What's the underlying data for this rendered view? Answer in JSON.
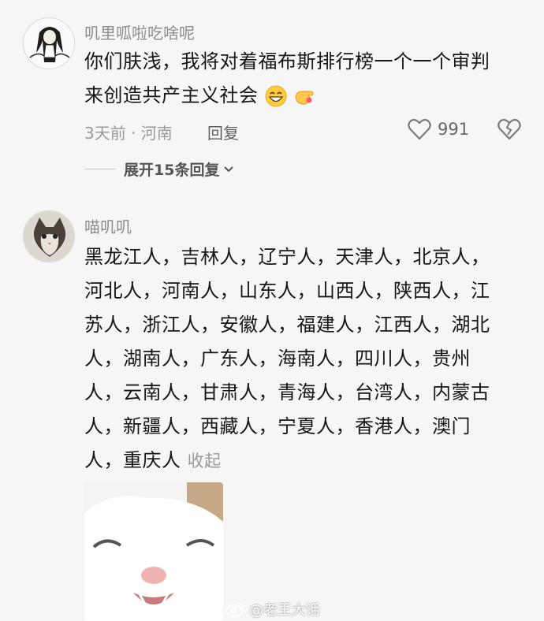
{
  "comments": [
    {
      "username": "叽里呱啦吃啥呢",
      "text_line1": "你们肤浅，我将对着福布斯排行榜一个一个审判",
      "text_line2": "来创造共产主义社会",
      "meta": "3天前 · 河南",
      "reply_label": "回复",
      "like_count": "991",
      "expand_label": "展开15条回复",
      "avatar_icon": "anime-girl-avatar",
      "emojis": [
        "grin-emoji",
        "pointing-hand-emoji"
      ]
    },
    {
      "username": "喵叽叽",
      "lines": [
        "黑龙江人，吉林人，辽宁人，天津人，北京人，",
        "河北人，河南人，山东人，山西人，陕西人，江",
        "苏人，浙江人，安徽人，福建人，江西人，湖北",
        "人，湖南人，广东人，海南人，四川人，贵州",
        "人，云南人，甘肃人，青海人，台湾人，内蒙古",
        "人，新疆人，西藏人，宁夏人，香港人，澳门"
      ],
      "last_line": "人，重庆人",
      "collapse_label": "收起",
      "avatar_icon": "cat-avatar",
      "sticker_icon": "smiling-cat-sticker"
    }
  ],
  "watermark": {
    "text": "@老王大话",
    "icon": "weibo-logo-icon"
  },
  "colors": {
    "background": "#f6f6f6",
    "text_primary": "#161616",
    "text_secondary": "#9a9a9a"
  }
}
